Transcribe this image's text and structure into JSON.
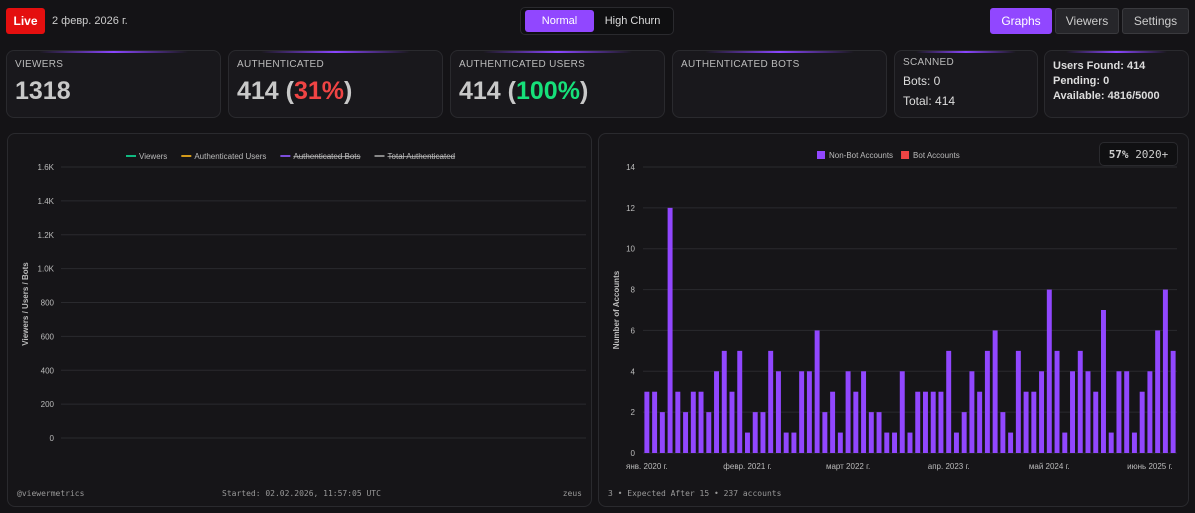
{
  "header": {
    "live": "Live",
    "date": "2 февр. 2026 г.",
    "modes": [
      "Normal",
      "High Churn"
    ],
    "nav": [
      "Graphs",
      "Viewers",
      "Settings"
    ]
  },
  "cards": {
    "viewers": {
      "label": "VIEWERS",
      "value": "1318"
    },
    "authenticated": {
      "label": "AUTHENTICATED",
      "value": "414",
      "pct": "31%"
    },
    "auth_users": {
      "label": "AUTHENTICATED USERS",
      "value": "414",
      "pct": "100%"
    },
    "auth_bots": {
      "label": "AUTHENTICATED BOTS"
    },
    "scanned": {
      "label": "SCANNED",
      "bots": "Bots: 0",
      "total": "Total: 414"
    },
    "status": {
      "found": "Users Found: 414",
      "pending": "Pending: 0",
      "available": "Available: 4816/5000"
    }
  },
  "left_footer": {
    "handle": "@viewermetrics",
    "started": "Started: 02.02.2026, 11:57:05 UTC",
    "user": "zeus"
  },
  "right_footer": "3 • Expected After 15 • 237 accounts",
  "badge": {
    "pct": "57%",
    "label": "2020+"
  },
  "colors": {
    "accent": "#9147ff",
    "live": "#e40f0f",
    "bar": "#9147ff",
    "bot": "#f04444"
  },
  "chart_data": [
    {
      "type": "line",
      "ylabel": "Viewers / Users / Bots",
      "ylim": [
        0,
        1600
      ],
      "yticks": [
        "0",
        "200",
        "400",
        "600",
        "800",
        "1.0K",
        "1.2K",
        "1.4K",
        "1.6K"
      ],
      "legend": [
        {
          "name": "Viewers",
          "color": "#10b981",
          "hidden": false
        },
        {
          "name": "Authenticated Users",
          "color": "#d49a1a",
          "hidden": false
        },
        {
          "name": "Authenticated Bots",
          "color": "#7c4ddb",
          "hidden": true
        },
        {
          "name": "Total Authenticated",
          "color": "#888888",
          "hidden": true
        }
      ],
      "legend_placement": "top",
      "grid": true,
      "series": []
    },
    {
      "type": "bar",
      "ylabel": "Number of Accounts",
      "ylim": [
        0,
        14
      ],
      "yticks": [
        0,
        2,
        4,
        6,
        8,
        10,
        12,
        14
      ],
      "grid": true,
      "legend_placement": "top",
      "legend": [
        {
          "name": "Non-Bot Accounts",
          "color": "#9147ff"
        },
        {
          "name": "Bot Accounts",
          "color": "#f04444"
        }
      ],
      "xticks": [
        {
          "index": 0,
          "label": "янв. 2020 г."
        },
        {
          "index": 13,
          "label": "февр. 2021 г."
        },
        {
          "index": 26,
          "label": "март 2022 г."
        },
        {
          "index": 39,
          "label": "апр. 2023 г."
        },
        {
          "index": 52,
          "label": "май 2024 г."
        },
        {
          "index": 65,
          "label": "июнь 2025 г."
        }
      ],
      "start_month": "2020-01",
      "values": [
        3,
        3,
        2,
        12,
        3,
        2,
        3,
        3,
        2,
        4,
        5,
        3,
        5,
        1,
        2,
        2,
        5,
        4,
        1,
        1,
        4,
        4,
        6,
        2,
        3,
        1,
        4,
        3,
        4,
        2,
        2,
        1,
        1,
        4,
        1,
        3,
        3,
        3,
        3,
        5,
        1,
        2,
        4,
        3,
        5,
        6,
        2,
        1,
        5,
        3,
        3,
        4,
        8,
        5,
        1,
        4,
        5,
        4,
        3,
        7,
        1,
        4,
        4,
        1,
        3,
        4,
        6,
        8,
        5
      ],
      "bot_values": []
    }
  ]
}
